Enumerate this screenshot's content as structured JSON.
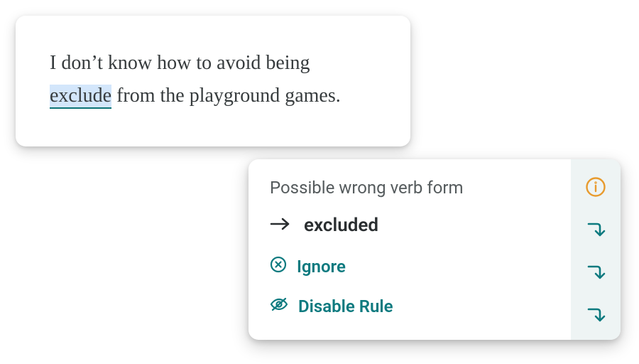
{
  "editor": {
    "text_before": "I don’t know how to avoid being ",
    "highlighted_word": "exclude",
    "text_after": " from the playground games."
  },
  "popup": {
    "title": "Possible wrong verb form",
    "correction": "excluded",
    "ignore_label": "Ignore",
    "disable_label": "Disable Rule"
  },
  "colors": {
    "accent_teal": "#0d7a7f",
    "info_orange": "#e89b2e",
    "highlight_bg": "#d3e6fb",
    "sidebar_bg": "#eef4f4"
  }
}
